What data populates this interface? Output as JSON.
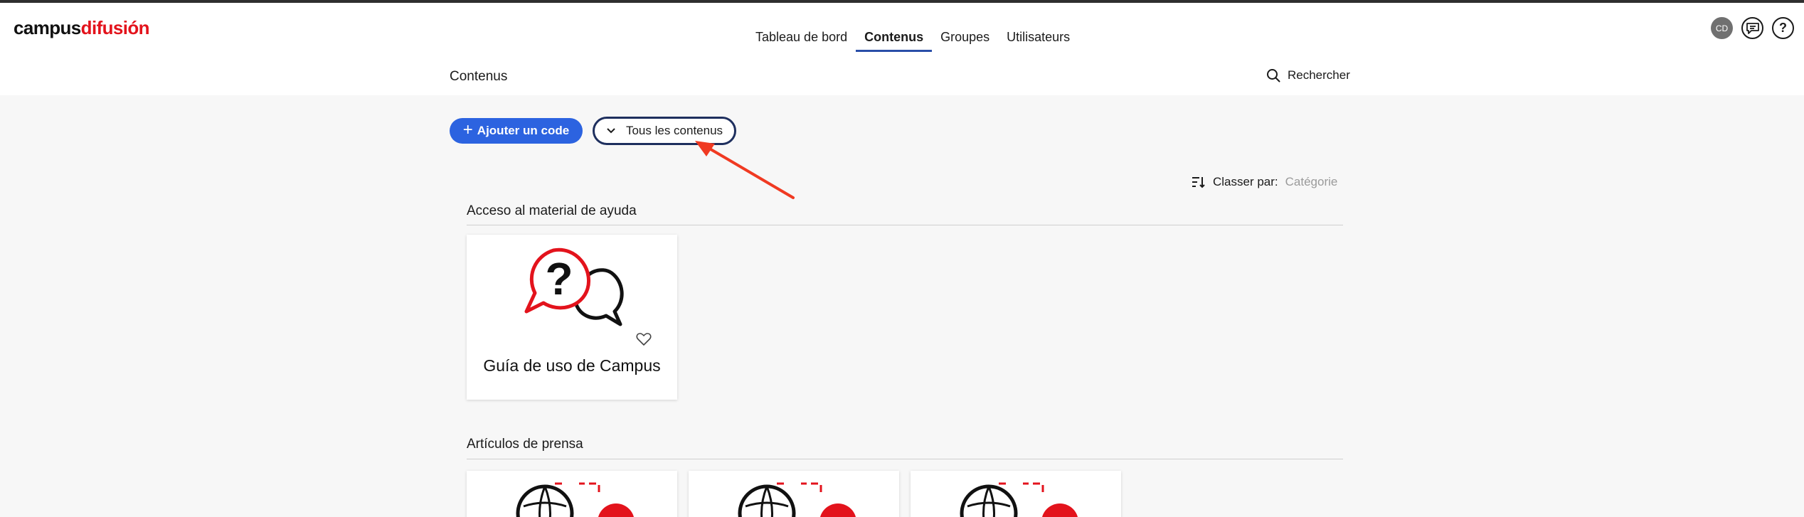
{
  "brand": {
    "part1": "campus",
    "part2": "difusión",
    "accent": "#e3131c"
  },
  "nav": {
    "items": [
      {
        "label": "Tableau de bord"
      },
      {
        "label": "Contenus"
      },
      {
        "label": "Groupes"
      },
      {
        "label": "Utilisateurs"
      }
    ],
    "active": "Contenus"
  },
  "header_right": {
    "avatar": "CD",
    "chat_icon": "chat-icon",
    "help_icon": "help-icon"
  },
  "page": {
    "title": "Contenus",
    "search_label": "Rechercher"
  },
  "actions": {
    "add_label": "Ajouter un code",
    "filter_label": "Tous les contenus"
  },
  "sort": {
    "label": "Classer par:",
    "value": "Catégorie"
  },
  "sections": [
    {
      "title": "Acceso al material de ayuda",
      "cards": [
        {
          "title": "Guía de uso de Campus"
        }
      ]
    },
    {
      "title": "Artículos de prensa",
      "cards": [
        {
          "title": ""
        },
        {
          "title": ""
        },
        {
          "title": ""
        }
      ]
    }
  ],
  "colors": {
    "primary": "#2c63e0",
    "active_underline": "#2a4fa8",
    "annotation_arrow": "#f03a22"
  }
}
